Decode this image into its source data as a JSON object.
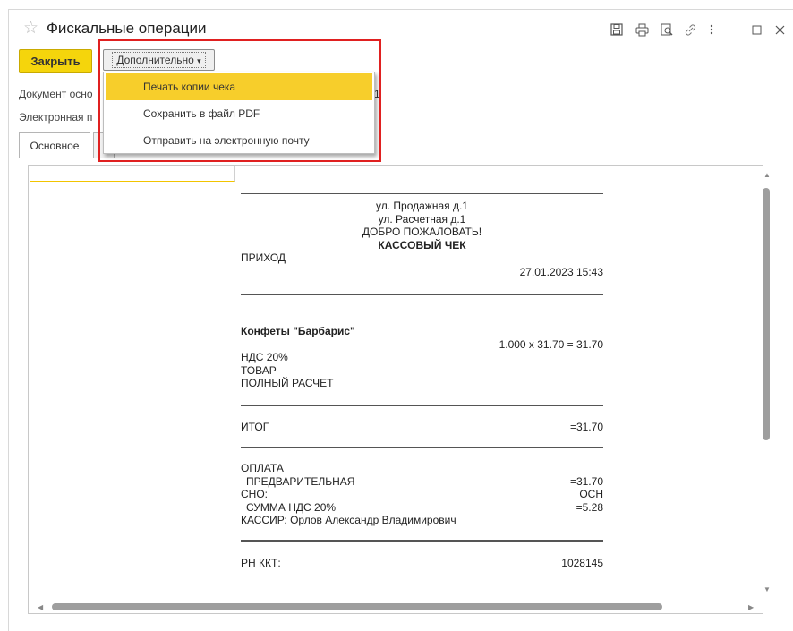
{
  "window": {
    "title": "Фискальные операции",
    "icons": [
      "star-icon",
      "save-icon",
      "print-icon",
      "preview-icon",
      "link-icon",
      "more-icon",
      "maximize-icon",
      "close-icon"
    ]
  },
  "toolbar": {
    "close_label": "Закрыть",
    "more_label": "Дополнительно"
  },
  "form": {
    "doc_label": "Документ осно",
    "email_label": "Электронная п",
    "doc_link_tail": "1"
  },
  "tabs": [
    {
      "label": "Основное"
    },
    {
      "label": ""
    }
  ],
  "menu": {
    "items": [
      {
        "label": "Печать копии чека"
      },
      {
        "label": "Сохранить в файл PDF"
      },
      {
        "label": "Отправить на электронную почту"
      }
    ]
  },
  "receipt": {
    "addr1": "ул. Продажная д.1",
    "addr2": "ул. Расчетная д.1",
    "welcome": "ДОБРО ПОЖАЛОВАТЬ!",
    "header": "КАССОВЫЙ ЧЕК",
    "op_type": "ПРИХОД",
    "datetime": "27.01.2023 15:43",
    "item_name": "Конфеты \"Барбарис\"",
    "item_calc": "1.000  x 31.70 = 31.70",
    "vat": "НДС 20%",
    "subject": "ТОВАР",
    "method": "ПОЛНЫЙ РАСЧЕТ",
    "total_label": "ИТОГ",
    "total_value": "=31.70",
    "payment_label": "ОПЛАТА",
    "prepay_label": "ПРЕДВАРИТЕЛЬНАЯ",
    "prepay_value": "=31.70",
    "sno_label": "СНО:",
    "sno_value": "ОСН",
    "vat_sum_label": "СУММА НДС 20%",
    "vat_sum_value": "=5.28",
    "cashier": "КАССИР: Орлов Александр Владимирович",
    "rn_label": "РН ККТ:",
    "rn_value": "1028145"
  },
  "colors": {
    "accent": "#f5d50c",
    "menu_highlight": "#f7ce2b",
    "annotation_border": "#e02020"
  }
}
